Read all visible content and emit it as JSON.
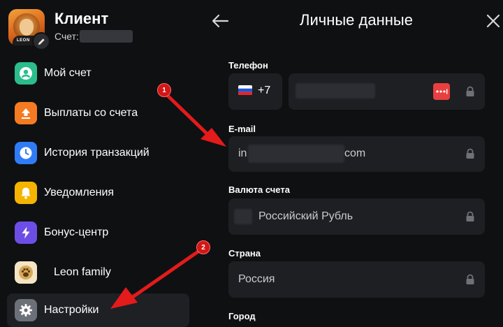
{
  "header": {
    "client_name": "Клиент",
    "account_label": "Счет:",
    "page_title": "Личные данные"
  },
  "avatar": {
    "logo_text": "LEON"
  },
  "sidebar": {
    "items": [
      {
        "label": "Мой счет",
        "icon": "user-icon",
        "color": "#2bbd8c"
      },
      {
        "label": "Выплаты со счета",
        "icon": "upload-icon",
        "color": "#f47b21"
      },
      {
        "label": "История транзакций",
        "icon": "clock-icon",
        "color": "#2f7cf6"
      },
      {
        "label": "Уведомления",
        "icon": "bell-icon",
        "color": "#f4b400"
      },
      {
        "label": "Бонус-центр",
        "icon": "lightning-icon",
        "color": "#6c4ee6"
      },
      {
        "label": "Leon family",
        "icon": "paw-icon",
        "color": "#d8a85a"
      },
      {
        "label": "Настройки",
        "icon": "gear-icon",
        "color": "#6b7079",
        "active": true
      }
    ]
  },
  "form": {
    "phone": {
      "label": "Телефон",
      "country_code": "+7"
    },
    "email": {
      "label": "E-mail",
      "value_start": "in",
      "value_end": "com"
    },
    "currency": {
      "label": "Валюта счета",
      "value": "Российский Рубль"
    },
    "country": {
      "label": "Страна",
      "value": "Россия"
    },
    "city": {
      "label": "Город"
    }
  },
  "annotations": {
    "marker_1": "1",
    "marker_2": "2",
    "color": "#e31b1b"
  },
  "colors": {
    "background": "#0f1012",
    "field": "#1d1f23",
    "active_menu": "#1e2024",
    "accent_red": "#e84040"
  }
}
